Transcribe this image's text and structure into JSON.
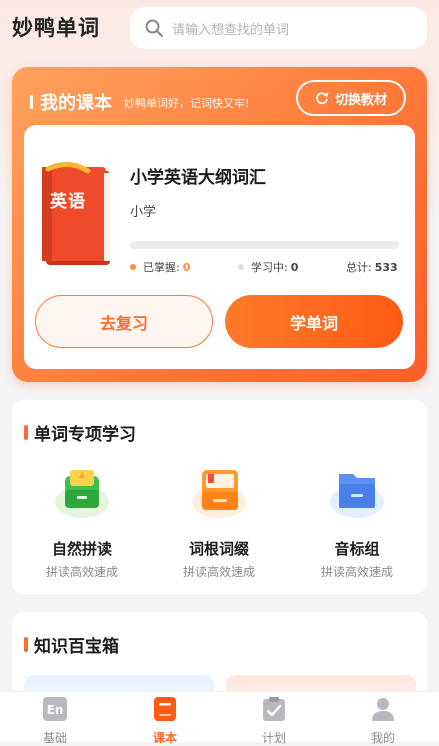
{
  "header": {
    "app_title": "妙鸭单词",
    "search_placeholder": "请输入想查找的单词"
  },
  "my_course": {
    "title": "我的课本",
    "subtitle": "妙鸭单词好，记词快又牢!",
    "switch_label": "切换教材",
    "book_cover_text": "英语",
    "course_name": "小学英语大纲词汇",
    "level": "小学",
    "progress_fraction": 0,
    "stats": {
      "mastered_label": "已掌握:",
      "mastered_value": "0",
      "learning_label": "学习中:",
      "learning_value": "0",
      "total_label": "总计:",
      "total_value": "533"
    },
    "review_label": "去复习",
    "learn_label": "学单词"
  },
  "special_study": {
    "title": "单词专项学习",
    "items": [
      {
        "name": "自然拼读",
        "desc": "拼读高效速成",
        "icon": "green-box-icon"
      },
      {
        "name": "词根词缀",
        "desc": "拼读高效速成",
        "icon": "orange-book-icon"
      },
      {
        "name": "音标组",
        "desc": "拼读高效速成",
        "icon": "blue-folder-icon"
      }
    ]
  },
  "knowledge_box": {
    "title": "知识百宝箱"
  },
  "tabbar": {
    "items": [
      {
        "label": "基础",
        "icon": "en-icon",
        "active": false
      },
      {
        "label": "课本",
        "icon": "textbook-icon",
        "active": true
      },
      {
        "label": "计划",
        "icon": "clipboard-icon",
        "active": false
      },
      {
        "label": "我的",
        "icon": "person-icon",
        "active": false
      }
    ]
  },
  "colors": {
    "accent": "#ff6a2e",
    "accent_light": "#ffa25c",
    "mastered_dot": "#ff8a3d",
    "learning_dot": "#e0e0e4"
  }
}
